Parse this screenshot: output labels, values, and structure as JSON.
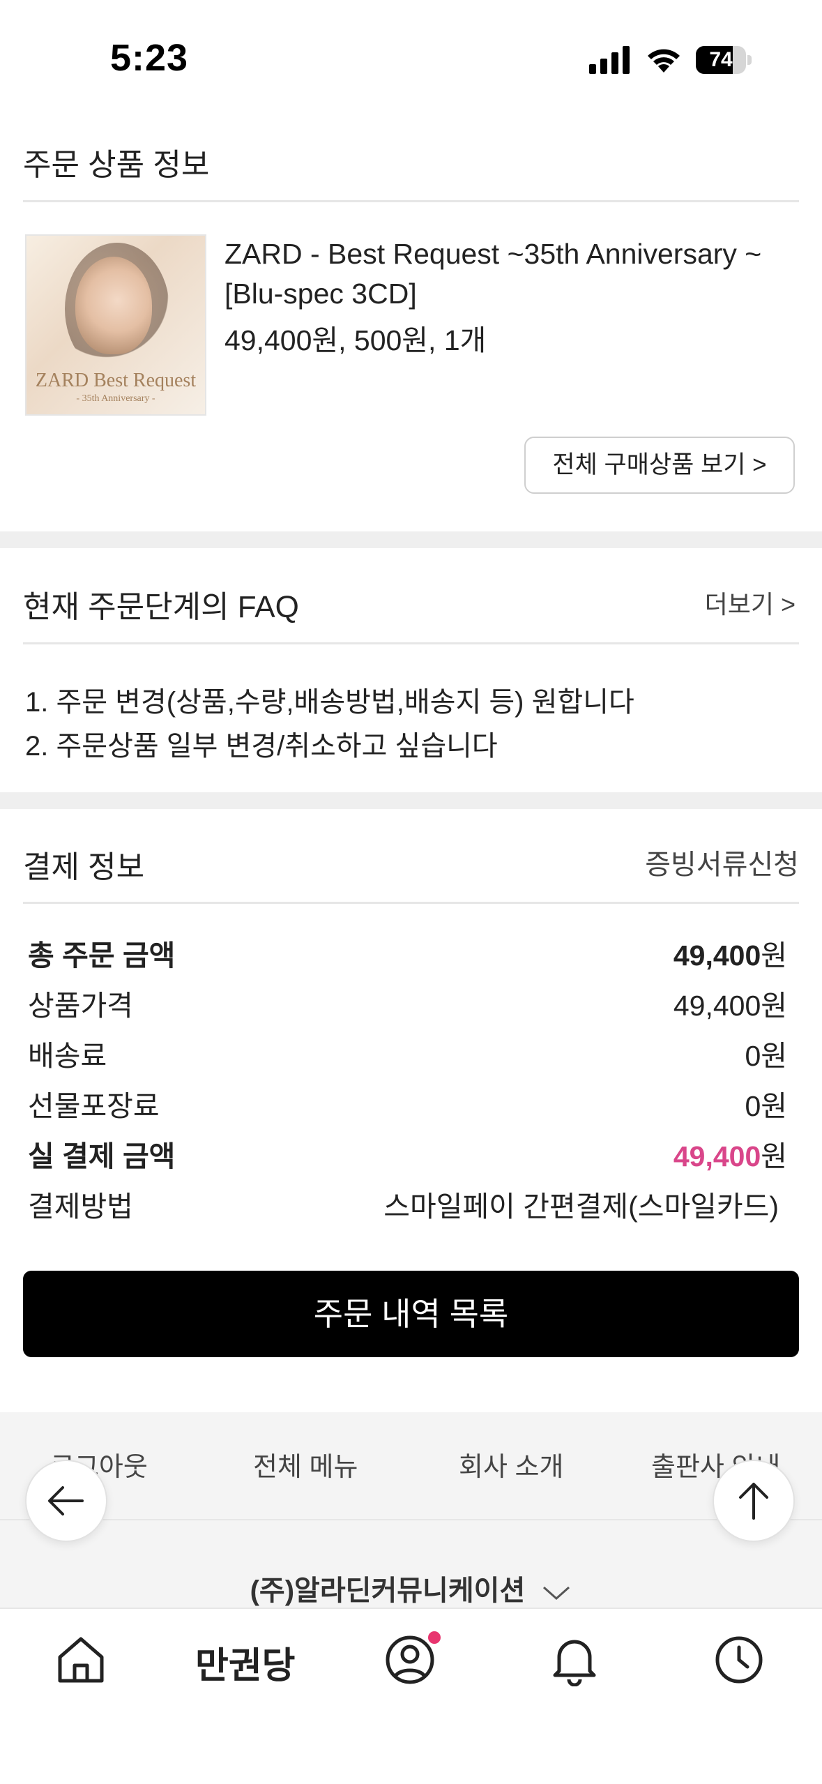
{
  "status_bar": {
    "time": "5:23",
    "battery": "74",
    "battery_level": 0.74
  },
  "order_product": {
    "section_title": "주문 상품 정보",
    "album_art_text": "ZARD Best Request",
    "album_art_subtext": "- 35th Anniversary -",
    "title": "ZARD - Best Request ~35th Anniversary ~ [Blu-spec 3CD]",
    "meta": "49,400원, 500원, 1개",
    "view_all_label": "전체 구매상품 보기 >"
  },
  "faq": {
    "section_title": "현재 주문단계의 FAQ",
    "more_label": "더보기 >",
    "items": [
      "1. 주문 변경(상품,수량,배송방법,배송지 등) 원합니다",
      "2. 주문상품 일부 변경/취소하고 싶습니다"
    ]
  },
  "payment": {
    "section_title": "결제 정보",
    "docs_label": "증빙서류신청",
    "rows": [
      {
        "label": "총 주문 금액",
        "amount": "49,400",
        "unit": "원"
      },
      {
        "label": "상품가격",
        "value": "49,400원"
      },
      {
        "label": "배송료",
        "value": "0원"
      },
      {
        "label": "선물포장료",
        "value": "0원"
      },
      {
        "label": "실 결제 금액",
        "amount": "49,400",
        "unit": "원"
      },
      {
        "label": "결제방법",
        "value": "스마일페이 간편결제(스마일카드)"
      }
    ],
    "accent_color": "#d9468a"
  },
  "order_list_button": "주문 내역 목록",
  "footer": {
    "links": [
      "로그아웃",
      "전체 메뉴",
      "회사 소개",
      "출판사 안내"
    ],
    "company": "(주)알라딘커뮤니케이션"
  },
  "floating": {
    "back_icon": "arrow-left-icon",
    "top_icon": "arrow-up-icon"
  },
  "tab_bar": {
    "items": [
      "home-icon",
      "만권당",
      "profile-icon",
      "bell-icon",
      "clock-icon"
    ],
    "brand_label": "만권당",
    "notification_dot_color": "#e8356f"
  }
}
